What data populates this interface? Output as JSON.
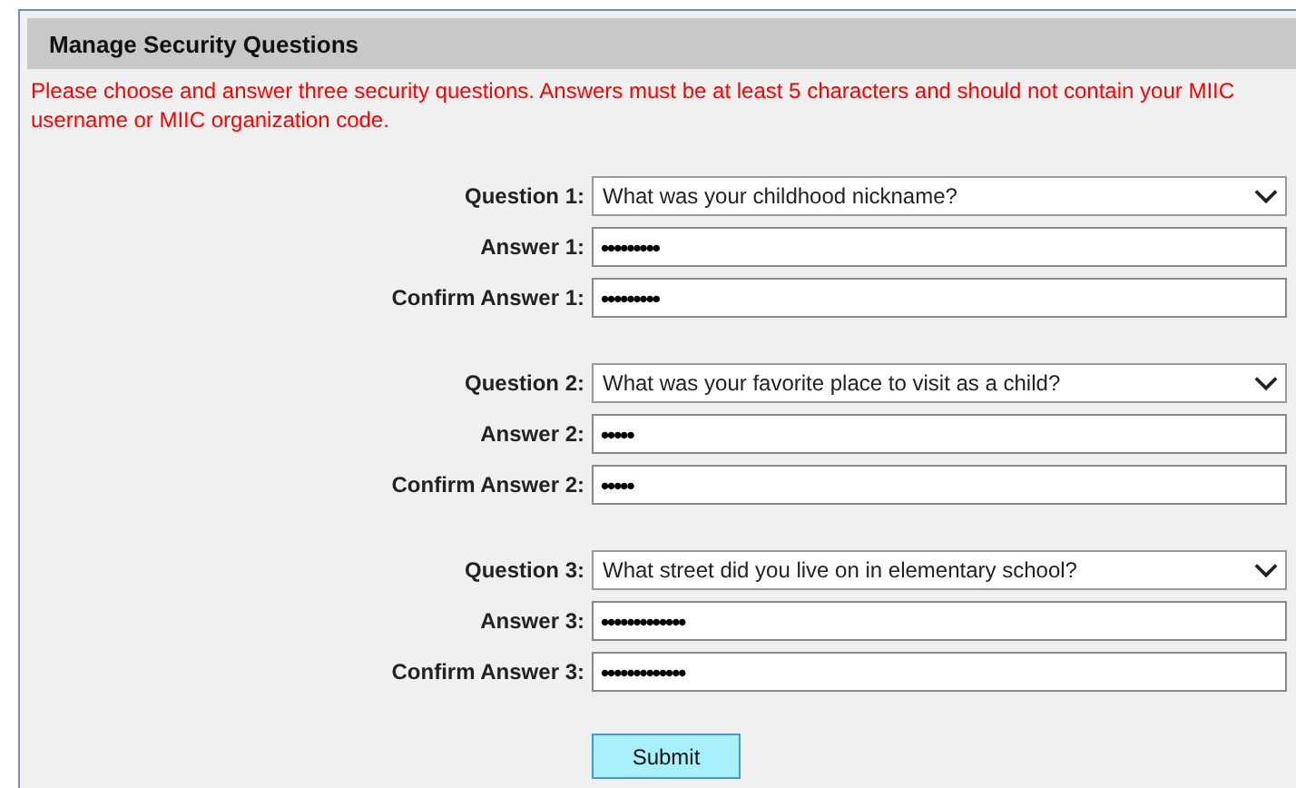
{
  "panel": {
    "title": "Manage Security Questions",
    "notice": "Please choose and answer three security questions. Answers must be at least 5 characters and should not contain your MIIC username or MIIC organization code."
  },
  "groups": [
    {
      "question_label": "Question 1:",
      "question": "What was your childhood nickname?",
      "answer_label": "Answer 1:",
      "answer": "•••••••••",
      "confirm_label": "Confirm Answer 1:",
      "confirm": "•••••••••"
    },
    {
      "question_label": "Question 2:",
      "question": "What was your favorite place to visit as a child?",
      "answer_label": "Answer 2:",
      "answer": "•••••",
      "confirm_label": "Confirm Answer 2:",
      "confirm": "•••••"
    },
    {
      "question_label": "Question 3:",
      "question": "What street did you live on in elementary school?",
      "answer_label": "Answer 3:",
      "answer": "•••••••••••••",
      "confirm_label": "Confirm Answer 3:",
      "confirm": "•••••••••••••"
    }
  ],
  "submit": "Submit"
}
